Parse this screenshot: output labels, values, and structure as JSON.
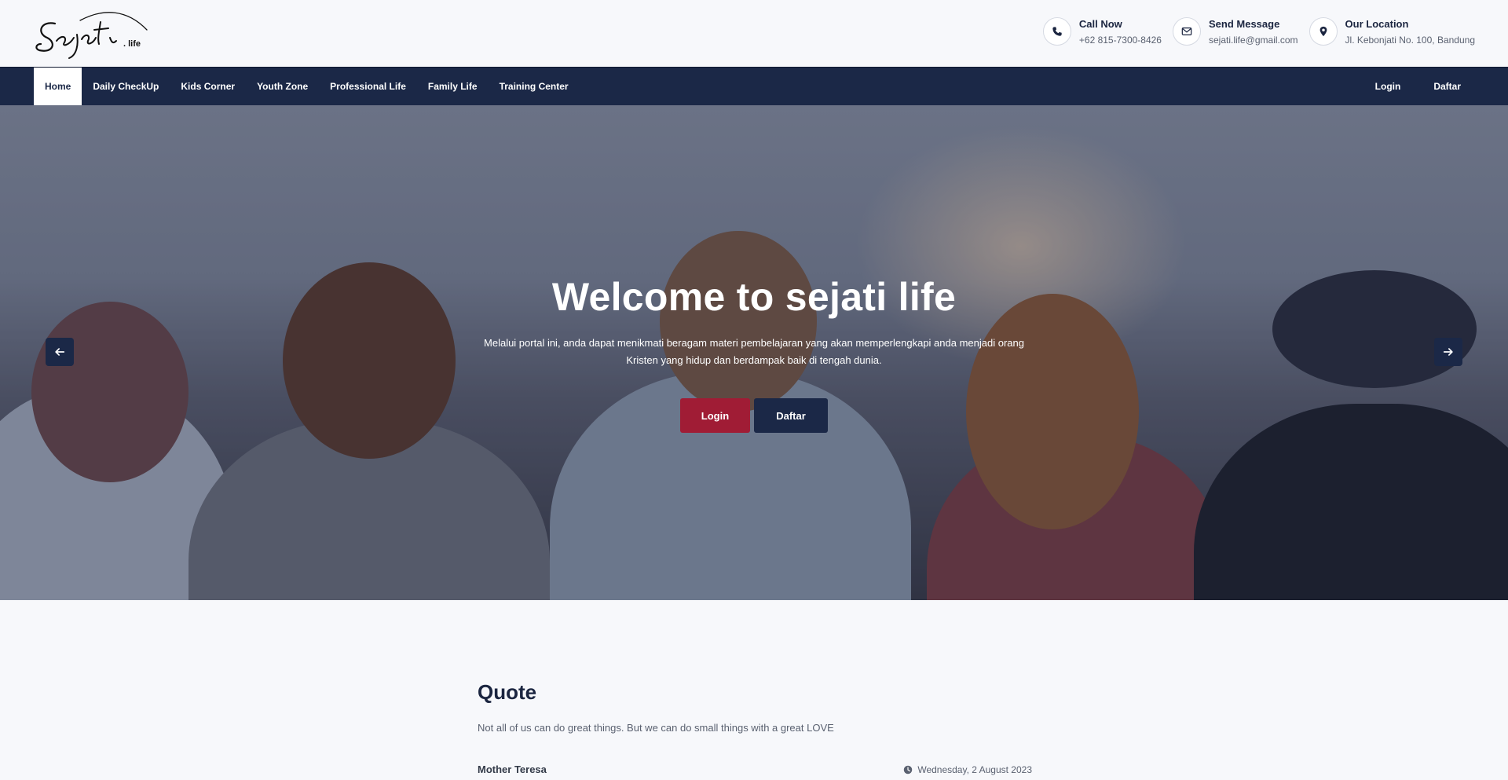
{
  "brand": {
    "logo_script": "Sejati",
    "logo_suffix": ". life"
  },
  "contacts": [
    {
      "title": "Call Now",
      "value": "+62 815-7300-8426",
      "icon": "phone-icon"
    },
    {
      "title": "Send Message",
      "value": "sejati.life@gmail.com",
      "icon": "envelope-icon"
    },
    {
      "title": "Our Location",
      "value": "Jl. Kebonjati No. 100, Bandung",
      "icon": "map-pin-icon"
    }
  ],
  "nav": {
    "items": [
      "Home",
      "Daily CheckUp",
      "Kids Corner",
      "Youth Zone",
      "Professional Life",
      "Family Life",
      "Training Center"
    ],
    "active": "Home",
    "right": [
      "Login",
      "Daftar"
    ]
  },
  "hero": {
    "title": "Welcome to sejati life",
    "text": "Melalui portal ini, anda dapat menikmati beragam materi pembelajaran yang akan memperlengkapi anda menjadi orang Kristen yang hidup dan berdampak baik di tengah dunia.",
    "login_label": "Login",
    "daftar_label": "Daftar"
  },
  "quote": {
    "heading": "Quote",
    "text": "Not all of us can do great things. But we can do small things with a great LOVE",
    "author": "Mother Teresa",
    "date": "Wednesday, 2 August 2023"
  },
  "colors": {
    "navy": "#1b2847",
    "crimson": "#a01c35",
    "background": "#f7f8fb"
  }
}
